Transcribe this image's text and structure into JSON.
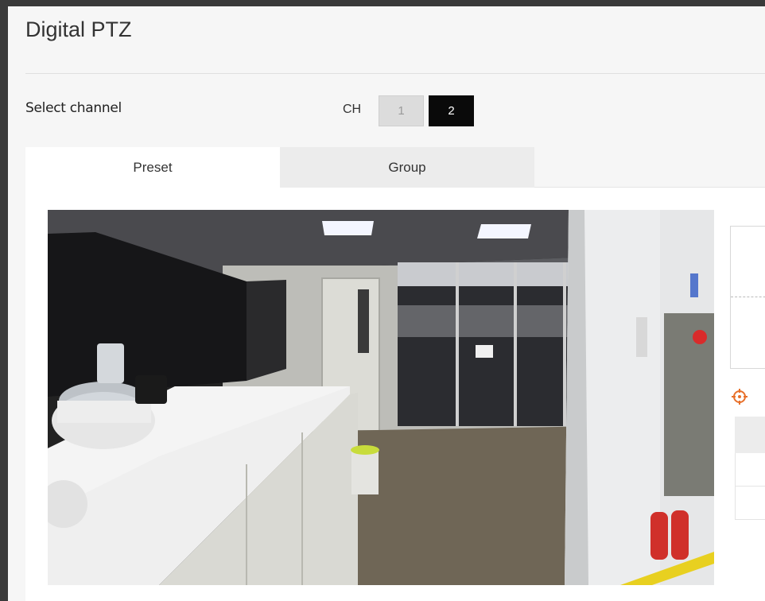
{
  "page": {
    "title": "Digital PTZ"
  },
  "channel": {
    "label": "Select channel",
    "prefix": "CH",
    "options": [
      "1",
      "2"
    ],
    "selected": "2"
  },
  "tabs": [
    {
      "label": "Preset",
      "active": true
    },
    {
      "label": "Group",
      "active": false
    }
  ],
  "icons": {
    "preset_target": "target-crosshair-icon"
  },
  "colors": {
    "accent": "#e8702a",
    "selected_channel_bg": "#0a0a0a"
  }
}
